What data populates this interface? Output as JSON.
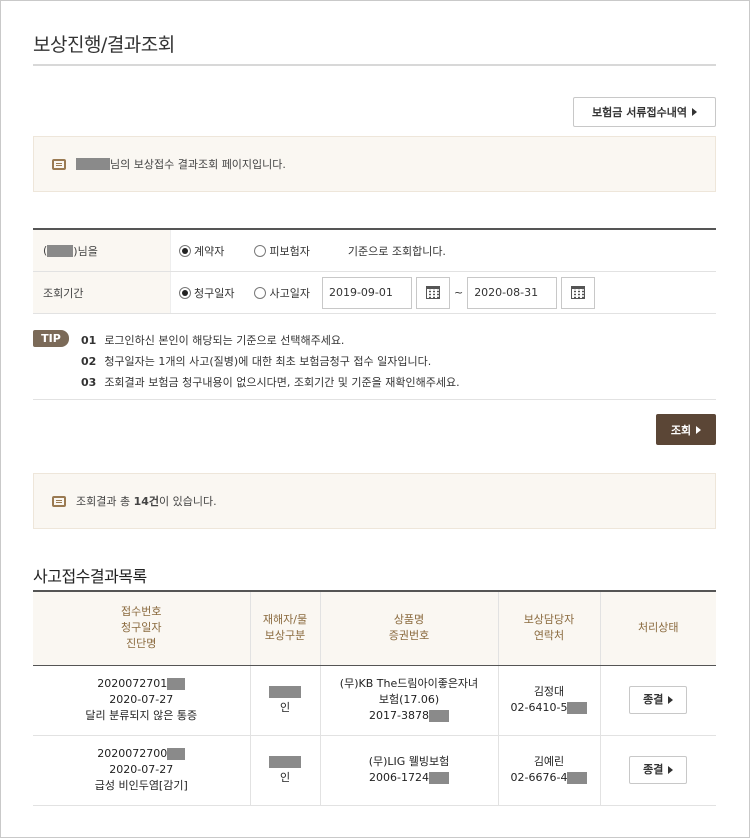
{
  "page": {
    "title": "보상진행/결과조회"
  },
  "docs_button": {
    "label": "보험금 서류접수내역"
  },
  "notice_top": {
    "text": "님의 보상접수 결과조회 페이지입니다."
  },
  "search": {
    "row1": {
      "label_prefix": "(",
      "label_suffix": ")님을",
      "options": [
        "계약자",
        "피보험자"
      ],
      "selected": "계약자",
      "suffix_text": "기준으로 조회합니다."
    },
    "row2": {
      "label": "조회기간",
      "options": [
        "청구일자",
        "사고일자"
      ],
      "selected": "청구일자",
      "date_from": "2019-09-01",
      "date_to": "2020-08-31",
      "tilde": "~"
    }
  },
  "tips": {
    "badge": "TIP",
    "items": [
      {
        "num": "01",
        "text": "로그인하신 본인이 해당되는 기준으로 선택해주세요."
      },
      {
        "num": "02",
        "text": "청구일자는 1개의 사고(질병)에 대한 최초 보험금청구 접수 일자입니다."
      },
      {
        "num": "03",
        "text": "조회결과 보험금 청구내용이 없으시다면, 조회기간 및 기준을 재확인해주세요."
      }
    ]
  },
  "query_button": {
    "label": "조회"
  },
  "notice_result": {
    "prefix": "조회결과 총 ",
    "count": "14건",
    "suffix": "이 있습니다."
  },
  "section": {
    "title": "사고접수결과목록"
  },
  "table": {
    "headers": [
      [
        "접수번호",
        "청구일자",
        "진단명"
      ],
      [
        "재해자/물",
        "보상구분"
      ],
      [
        "상품명",
        "증권번호"
      ],
      [
        "보상담당자",
        "연락처"
      ],
      [
        "처리상태"
      ]
    ],
    "rows": [
      {
        "receipt_no": "2020072701",
        "claim_date": "2020-07-27",
        "diagnosis": "달리 분류되지 않은 통증",
        "category": "인",
        "product": "(무)KB The드림아이좋은자녀",
        "product2": "보험(17.06)",
        "policy_no": "2017-3878",
        "manager": "김정대",
        "phone": "02-6410-5",
        "status": "종결"
      },
      {
        "receipt_no": "2020072700",
        "claim_date": "2020-07-27",
        "diagnosis": "급성 비인두염[감기]",
        "category": "인",
        "product": "(무)LIG 웰빙보험",
        "product2": "",
        "policy_no": "2006-1724",
        "manager": "김예린",
        "phone": "02-6676-4",
        "status": "종결"
      }
    ]
  }
}
